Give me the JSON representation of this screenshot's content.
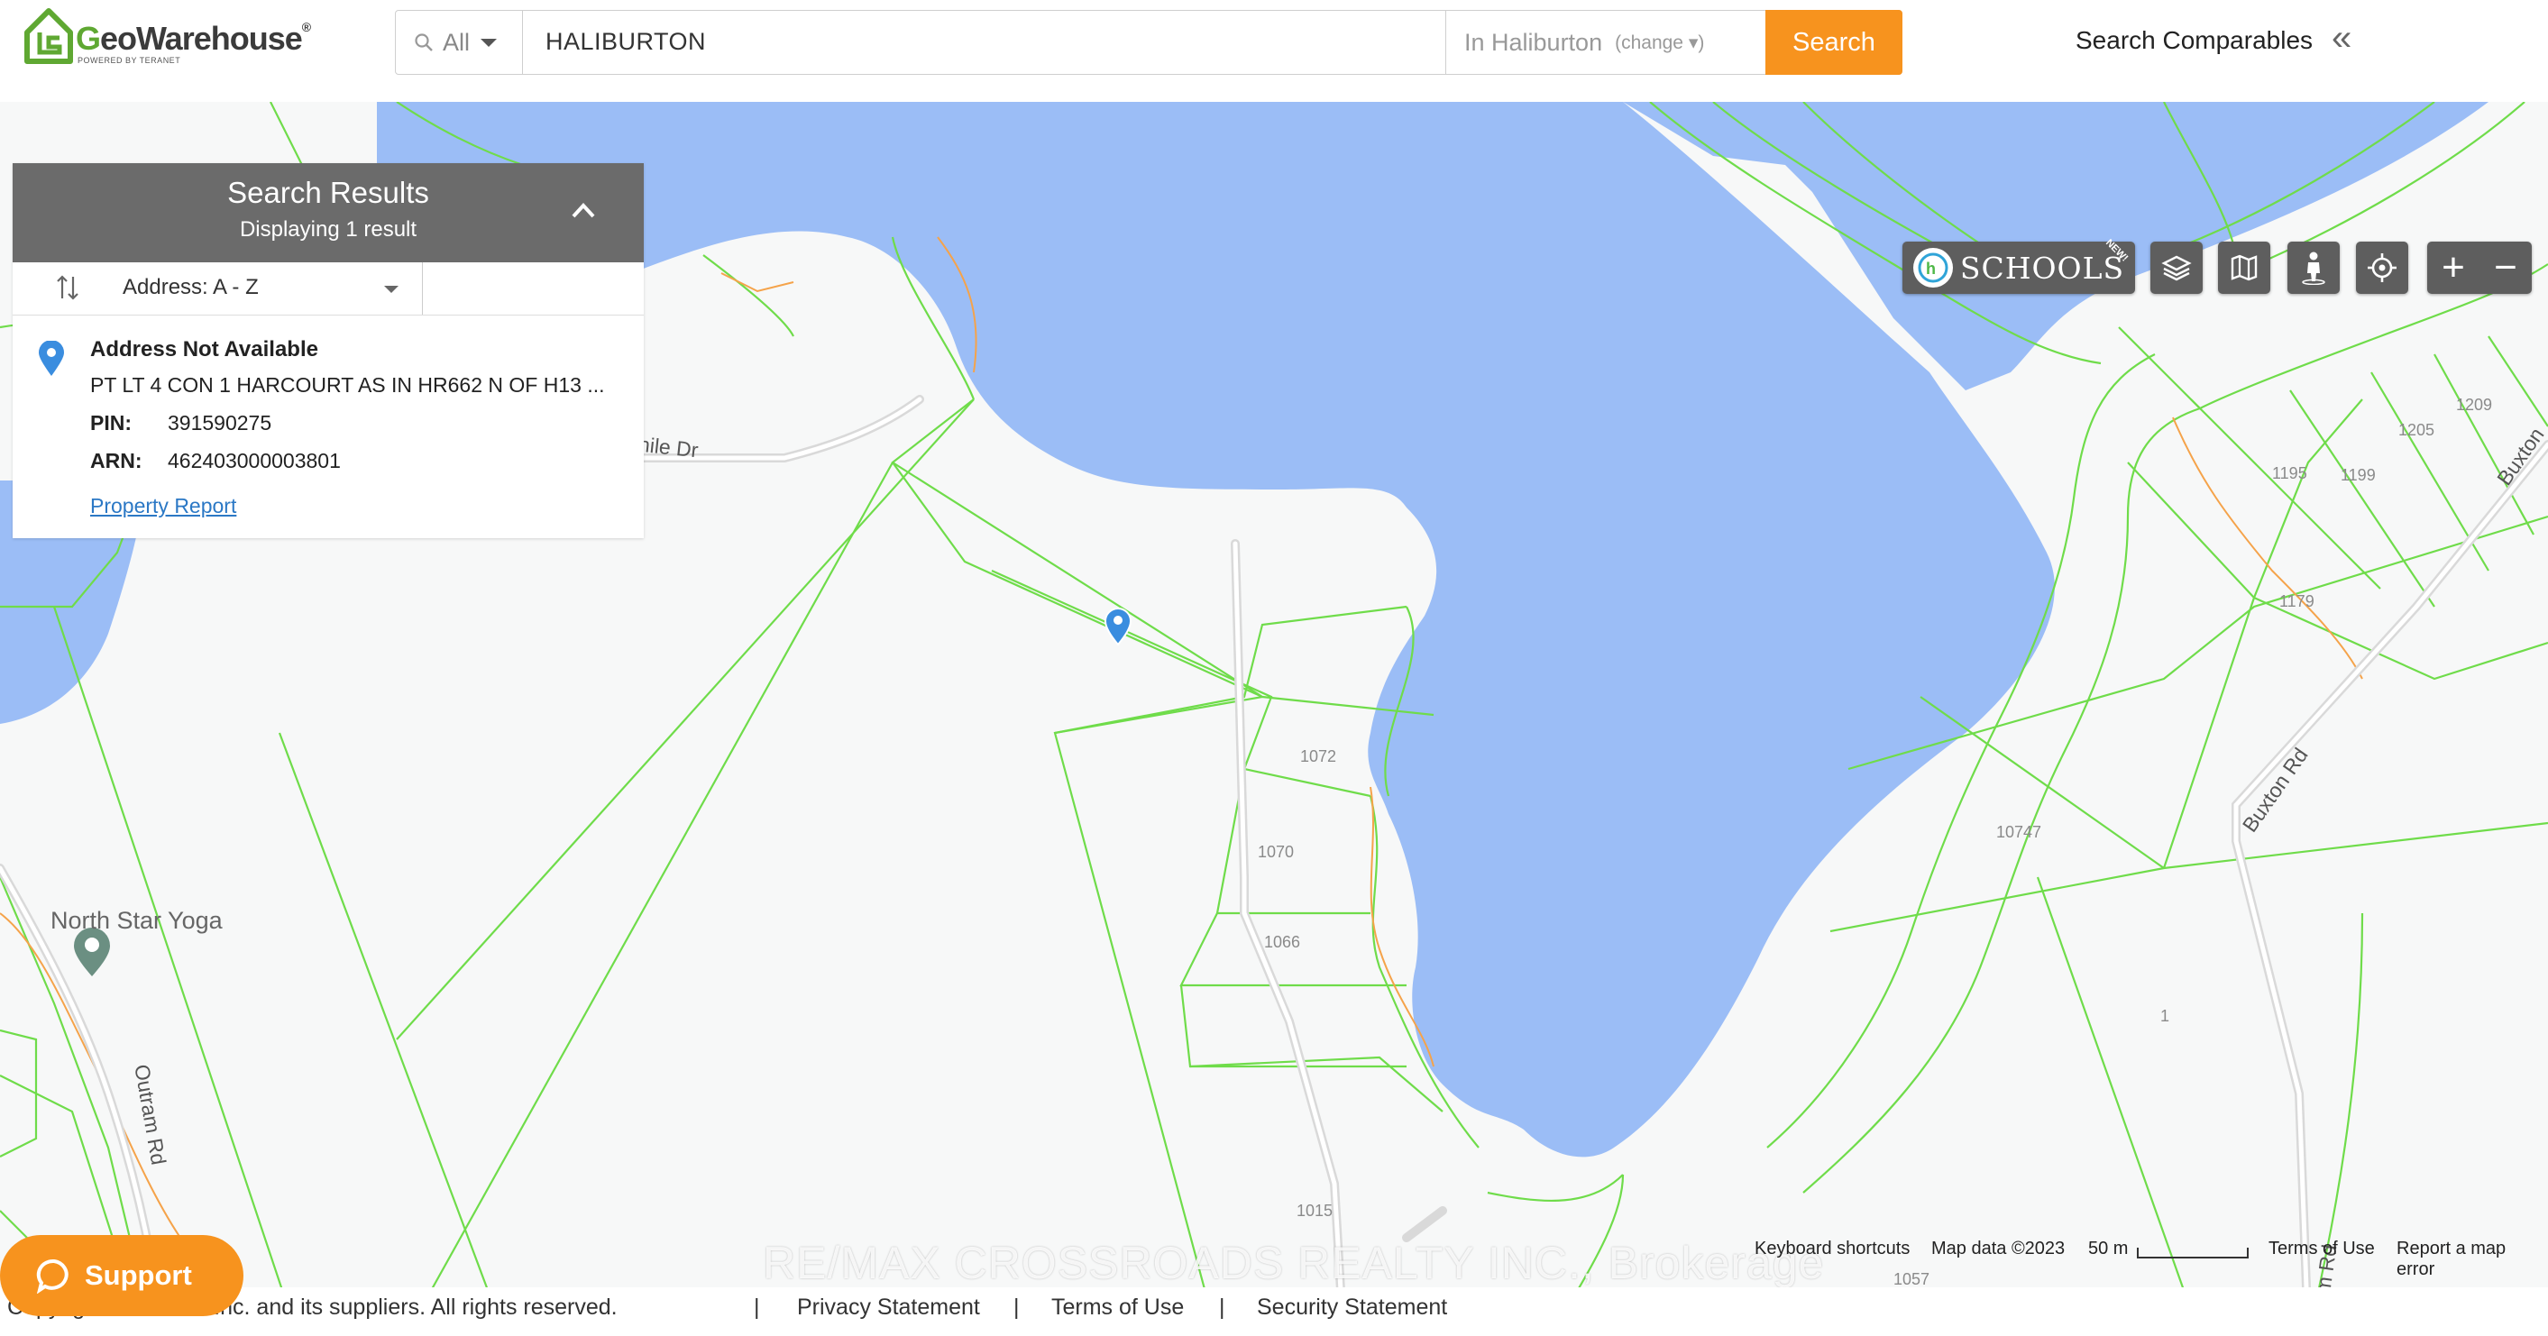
{
  "brand": {
    "name_prefix": "G",
    "name_rest": "eoWarehouse",
    "reg": "®",
    "tagline": "POWERED BY TERANET"
  },
  "search": {
    "filter": "All",
    "query": "HALIBURTON",
    "scope": "In Haliburton",
    "scope_change": "(change ▾)",
    "button": "Search"
  },
  "header": {
    "comparables": "Search Comparables",
    "collapse_glyph": "«"
  },
  "results": {
    "title": "Search Results",
    "subtitle": "Displaying 1 result",
    "sort": "Address: A - Z",
    "items": [
      {
        "title": "Address Not Available",
        "description": "PT LT 4 CON 1 HARCOURT AS IN HR662 N OF H13 ...",
        "pin_label": "PIN:",
        "pin": "391590275",
        "arn_label": "ARN:",
        "arn": "462403000003801",
        "link": "Property Report"
      }
    ]
  },
  "map": {
    "poi": "North Star Yoga",
    "roads": [
      "hile Dr",
      "Buxton Rd",
      "Buxton",
      "Outram Rd",
      "Outram Rd"
    ],
    "lot_numbers": [
      "1072",
      "1070",
      "1066",
      "1015",
      "1209",
      "1205",
      "1195",
      "1199",
      "1179",
      "10747",
      "1",
      "1057"
    ],
    "controls": {
      "schools": "SCHOOLS",
      "schools_badge": "NEW!",
      "zoom_in": "+",
      "zoom_out": "−"
    },
    "attribution": {
      "shortcuts": "Keyboard shortcuts",
      "mapdata": "Map data ©2023",
      "scale": "50 m",
      "terms": "Terms of Use",
      "report": "Report a map error"
    },
    "watermark": "RE/MAX CROSSROADS REALTY INC., Brokerage",
    "colors": {
      "water": "#9bbdf6",
      "parcel": "#6fdc4a",
      "land": "#f7f8f8",
      "accent": "#f7931e"
    }
  },
  "footer": {
    "copyright": "Copyright © Teranet Inc. and its suppliers. All rights reserved.",
    "links": [
      "Privacy Statement",
      "Terms of Use",
      "Security Statement"
    ],
    "separator": "|"
  },
  "support": {
    "label": "Support"
  }
}
